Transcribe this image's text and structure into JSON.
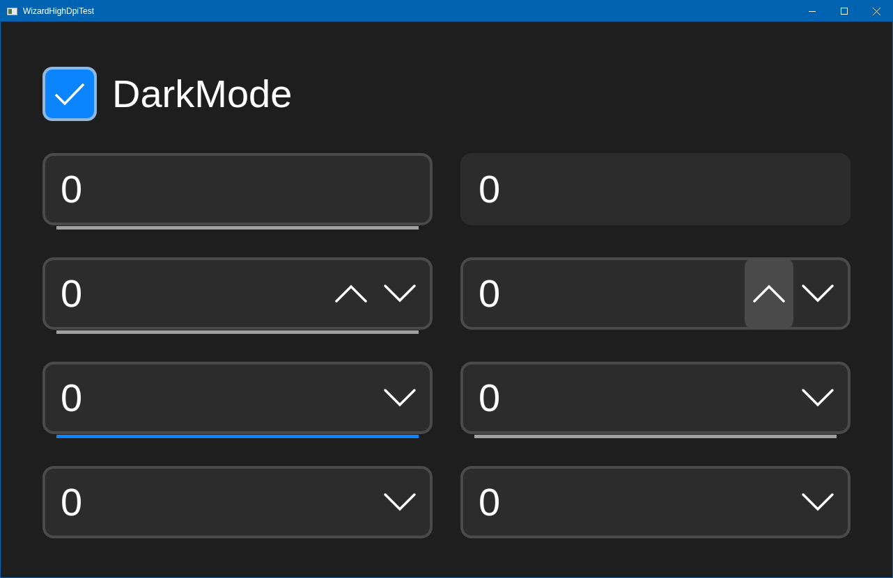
{
  "window": {
    "title": "WizardHighDpiTest"
  },
  "dark_mode": {
    "label": "DarkMode",
    "checked": true
  },
  "fields": [
    {
      "kind": "textbox",
      "value": "0",
      "bordered": true,
      "underlined": true,
      "focused": false
    },
    {
      "kind": "textbox",
      "value": "0",
      "bordered": false,
      "underlined": false,
      "focused": false
    },
    {
      "kind": "numeric",
      "value": "0",
      "bordered": true,
      "underlined": true,
      "focused": false,
      "up_hovered": false
    },
    {
      "kind": "numeric",
      "value": "0",
      "bordered": true,
      "underlined": false,
      "focused": false,
      "up_hovered": true
    },
    {
      "kind": "combo",
      "value": "0",
      "bordered": true,
      "underlined": true,
      "focused": true
    },
    {
      "kind": "combo",
      "value": "0",
      "bordered": true,
      "underlined": true,
      "focused": false
    },
    {
      "kind": "combo",
      "value": "0",
      "bordered": true,
      "underlined": false,
      "focused": false
    },
    {
      "kind": "combo",
      "value": "0",
      "bordered": true,
      "underlined": false,
      "focused": false
    }
  ]
}
